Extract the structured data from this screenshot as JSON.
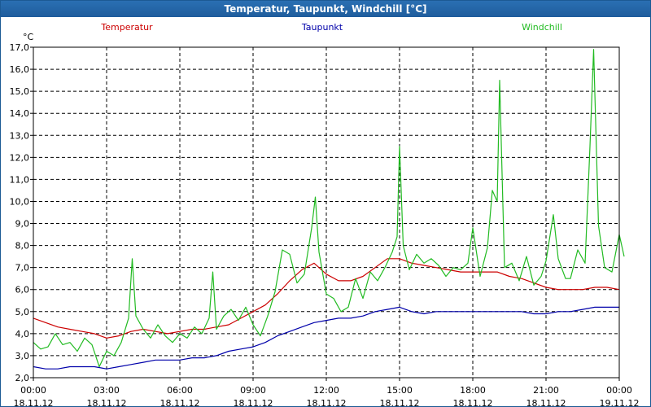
{
  "window": {
    "title": "Temperatur, Taupunkt, Windchill [°C]"
  },
  "chart_data": {
    "type": "line",
    "title": "Temperatur, Taupunkt, Windchill [°C]",
    "ylabel": "°C",
    "ylim": [
      2.0,
      17.0
    ],
    "y_ticks": [
      "2,0",
      "3,0",
      "4,0",
      "5,0",
      "6,0",
      "7,0",
      "8,0",
      "9,0",
      "10,0",
      "11,0",
      "12,0",
      "13,0",
      "14,0",
      "15,0",
      "16,0",
      "17,0"
    ],
    "x_range_hours": [
      0,
      24
    ],
    "x_ticks": [
      {
        "time": "00:00",
        "date": "18.11.12"
      },
      {
        "time": "03:00",
        "date": "18.11.12"
      },
      {
        "time": "06:00",
        "date": "18.11.12"
      },
      {
        "time": "09:00",
        "date": "18.11.12"
      },
      {
        "time": "12:00",
        "date": "18.11.12"
      },
      {
        "time": "15:00",
        "date": "18.11.12"
      },
      {
        "time": "18:00",
        "date": "18.11.12"
      },
      {
        "time": "21:00",
        "date": "18.11.12"
      },
      {
        "time": "00:00",
        "date": "19.11.12"
      }
    ],
    "grid": true,
    "legend_position": "top",
    "series": [
      {
        "name": "Temperatur",
        "color": "#cc0000",
        "points": [
          [
            0,
            4.7
          ],
          [
            0.5,
            4.5
          ],
          [
            1,
            4.3
          ],
          [
            1.5,
            4.2
          ],
          [
            2,
            4.1
          ],
          [
            2.5,
            4.0
          ],
          [
            3,
            3.8
          ],
          [
            3.5,
            3.9
          ],
          [
            4,
            4.1
          ],
          [
            4.5,
            4.2
          ],
          [
            5,
            4.1
          ],
          [
            5.5,
            4.0
          ],
          [
            6,
            4.1
          ],
          [
            6.5,
            4.2
          ],
          [
            7,
            4.2
          ],
          [
            7.5,
            4.3
          ],
          [
            8,
            4.4
          ],
          [
            8.5,
            4.7
          ],
          [
            9,
            5.0
          ],
          [
            9.5,
            5.3
          ],
          [
            10,
            5.8
          ],
          [
            10.5,
            6.4
          ],
          [
            11,
            6.9
          ],
          [
            11.5,
            7.2
          ],
          [
            12,
            6.7
          ],
          [
            12.5,
            6.4
          ],
          [
            13,
            6.4
          ],
          [
            13.5,
            6.6
          ],
          [
            14,
            7.0
          ],
          [
            14.5,
            7.4
          ],
          [
            15,
            7.4
          ],
          [
            15.5,
            7.2
          ],
          [
            16,
            7.1
          ],
          [
            16.5,
            7.0
          ],
          [
            17,
            6.9
          ],
          [
            17.5,
            6.8
          ],
          [
            18,
            6.8
          ],
          [
            18.5,
            6.8
          ],
          [
            19,
            6.8
          ],
          [
            19.5,
            6.6
          ],
          [
            20,
            6.5
          ],
          [
            20.5,
            6.3
          ],
          [
            21,
            6.1
          ],
          [
            21.5,
            6.0
          ],
          [
            22,
            6.0
          ],
          [
            22.5,
            6.0
          ],
          [
            23,
            6.1
          ],
          [
            23.5,
            6.1
          ],
          [
            24,
            6.0
          ]
        ]
      },
      {
        "name": "Taupunkt",
        "color": "#0000aa",
        "points": [
          [
            0,
            2.5
          ],
          [
            0.5,
            2.4
          ],
          [
            1,
            2.4
          ],
          [
            1.5,
            2.5
          ],
          [
            2,
            2.5
          ],
          [
            2.5,
            2.5
          ],
          [
            3,
            2.4
          ],
          [
            3.5,
            2.5
          ],
          [
            4,
            2.6
          ],
          [
            4.5,
            2.7
          ],
          [
            5,
            2.8
          ],
          [
            5.5,
            2.8
          ],
          [
            6,
            2.8
          ],
          [
            6.5,
            2.9
          ],
          [
            7,
            2.9
          ],
          [
            7.5,
            3.0
          ],
          [
            8,
            3.2
          ],
          [
            8.5,
            3.3
          ],
          [
            9,
            3.4
          ],
          [
            9.5,
            3.6
          ],
          [
            10,
            3.9
          ],
          [
            10.5,
            4.1
          ],
          [
            11,
            4.3
          ],
          [
            11.5,
            4.5
          ],
          [
            12,
            4.6
          ],
          [
            12.5,
            4.7
          ],
          [
            13,
            4.7
          ],
          [
            13.5,
            4.8
          ],
          [
            14,
            5.0
          ],
          [
            14.5,
            5.1
          ],
          [
            15,
            5.2
          ],
          [
            15.5,
            5.0
          ],
          [
            16,
            4.9
          ],
          [
            16.5,
            5.0
          ],
          [
            17,
            5.0
          ],
          [
            17.5,
            5.0
          ],
          [
            18,
            5.0
          ],
          [
            18.5,
            5.0
          ],
          [
            19,
            5.0
          ],
          [
            19.5,
            5.0
          ],
          [
            20,
            5.0
          ],
          [
            20.5,
            4.9
          ],
          [
            21,
            4.9
          ],
          [
            21.5,
            5.0
          ],
          [
            22,
            5.0
          ],
          [
            22.5,
            5.1
          ],
          [
            23,
            5.2
          ],
          [
            23.5,
            5.2
          ],
          [
            24,
            5.2
          ]
        ]
      },
      {
        "name": "Windchill",
        "color": "#22bb22",
        "points": [
          [
            0,
            3.6
          ],
          [
            0.3,
            3.3
          ],
          [
            0.6,
            3.4
          ],
          [
            0.9,
            4.0
          ],
          [
            1.2,
            3.5
          ],
          [
            1.5,
            3.6
          ],
          [
            1.8,
            3.2
          ],
          [
            2.1,
            3.8
          ],
          [
            2.4,
            3.5
          ],
          [
            2.7,
            2.5
          ],
          [
            3,
            3.2
          ],
          [
            3.3,
            3.0
          ],
          [
            3.6,
            3.6
          ],
          [
            3.9,
            4.7
          ],
          [
            4.05,
            7.4
          ],
          [
            4.2,
            4.8
          ],
          [
            4.5,
            4.2
          ],
          [
            4.8,
            3.8
          ],
          [
            5.1,
            4.4
          ],
          [
            5.4,
            3.9
          ],
          [
            5.7,
            3.6
          ],
          [
            6.0,
            4.0
          ],
          [
            6.3,
            3.8
          ],
          [
            6.6,
            4.3
          ],
          [
            6.9,
            4.0
          ],
          [
            7.2,
            4.7
          ],
          [
            7.35,
            6.8
          ],
          [
            7.5,
            4.2
          ],
          [
            7.8,
            4.8
          ],
          [
            8.1,
            5.1
          ],
          [
            8.4,
            4.6
          ],
          [
            8.7,
            5.2
          ],
          [
            9.0,
            4.4
          ],
          [
            9.3,
            3.9
          ],
          [
            9.6,
            4.8
          ],
          [
            9.9,
            5.9
          ],
          [
            10.2,
            7.8
          ],
          [
            10.5,
            7.6
          ],
          [
            10.8,
            6.3
          ],
          [
            11.1,
            6.7
          ],
          [
            11.4,
            8.8
          ],
          [
            11.55,
            10.2
          ],
          [
            11.7,
            7.7
          ],
          [
            12.0,
            5.8
          ],
          [
            12.3,
            5.6
          ],
          [
            12.6,
            5.0
          ],
          [
            12.9,
            5.2
          ],
          [
            13.2,
            6.5
          ],
          [
            13.5,
            5.6
          ],
          [
            13.8,
            6.8
          ],
          [
            14.1,
            6.4
          ],
          [
            14.4,
            7.0
          ],
          [
            14.7,
            7.7
          ],
          [
            14.9,
            8.4
          ],
          [
            15.0,
            12.5
          ],
          [
            15.15,
            8.0
          ],
          [
            15.4,
            6.9
          ],
          [
            15.7,
            7.6
          ],
          [
            16.0,
            7.2
          ],
          [
            16.3,
            7.4
          ],
          [
            16.6,
            7.1
          ],
          [
            16.9,
            6.6
          ],
          [
            17.2,
            7.0
          ],
          [
            17.5,
            6.9
          ],
          [
            17.8,
            7.2
          ],
          [
            18.0,
            8.8
          ],
          [
            18.3,
            6.6
          ],
          [
            18.6,
            7.9
          ],
          [
            18.8,
            10.5
          ],
          [
            19.0,
            10.0
          ],
          [
            19.1,
            15.5
          ],
          [
            19.3,
            7.0
          ],
          [
            19.6,
            7.2
          ],
          [
            19.9,
            6.4
          ],
          [
            20.2,
            7.5
          ],
          [
            20.5,
            6.2
          ],
          [
            20.8,
            6.6
          ],
          [
            21.0,
            7.3
          ],
          [
            21.3,
            9.4
          ],
          [
            21.5,
            7.4
          ],
          [
            21.8,
            6.5
          ],
          [
            22.0,
            6.5
          ],
          [
            22.3,
            7.8
          ],
          [
            22.6,
            7.2
          ],
          [
            22.8,
            12.5
          ],
          [
            22.95,
            16.9
          ],
          [
            23.15,
            8.9
          ],
          [
            23.4,
            7.0
          ],
          [
            23.7,
            6.8
          ],
          [
            24.0,
            8.5
          ],
          [
            24.2,
            7.5
          ]
        ]
      }
    ]
  }
}
